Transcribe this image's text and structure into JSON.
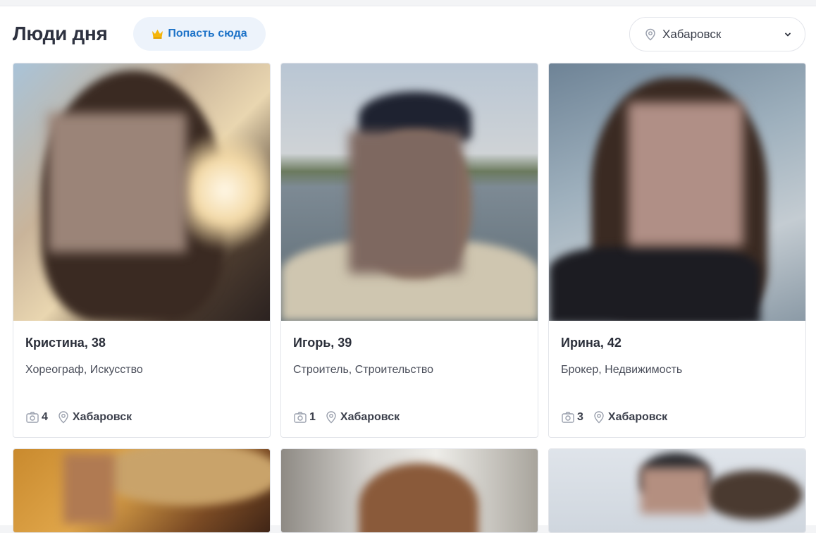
{
  "header": {
    "title": "Люди дня",
    "promo_label": "Попасть сюда",
    "city": "Хабаровск",
    "icons": {
      "promo": "crown-icon",
      "city": "location-pin-icon",
      "chevron": "chevron-down-icon"
    }
  },
  "colors": {
    "accent": "#1e73c8",
    "crown": "#f5b50a",
    "promo_bg": "#edf3fb"
  },
  "cards": [
    {
      "name": "Кристина, 38",
      "job": "Хореограф, Искусство",
      "photos": "4",
      "city": "Хабаровск"
    },
    {
      "name": "Игорь, 39",
      "job": "Строитель, Строительство",
      "photos": "1",
      "city": "Хабаровск"
    },
    {
      "name": "Ирина, 42",
      "job": "Брокер, Недвижимость",
      "photos": "3",
      "city": "Хабаровск"
    },
    {
      "name": "",
      "job": "",
      "photos": "",
      "city": ""
    },
    {
      "name": "",
      "job": "",
      "photos": "",
      "city": ""
    },
    {
      "name": "",
      "job": "",
      "photos": "",
      "city": ""
    }
  ]
}
